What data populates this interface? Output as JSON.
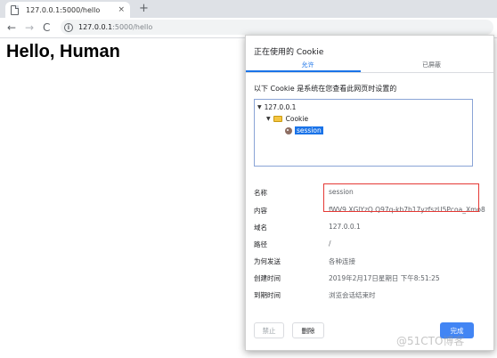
{
  "browser": {
    "tab_title": "127.0.0.1:5000/hello",
    "tab_close": "×",
    "new_tab": "+",
    "back": "←",
    "forward": "→",
    "reload": "C",
    "url_host": "127.0.0.1",
    "url_path": ":5000/hello",
    "info_glyph": "i"
  },
  "page": {
    "heading": "Hello, Human"
  },
  "dialog": {
    "title": "正在使用的 Cookie",
    "tabs": [
      "允许",
      "已屏蔽"
    ],
    "description": "以下 Cookie 是系统在您查看此网页时设置的",
    "tree": {
      "host": "127.0.0.1",
      "folder": "Cookie",
      "item": "session"
    },
    "fields": [
      {
        "label": "名称",
        "value": "session"
      },
      {
        "label": "内容",
        "value": "fWV9.XGlYzQ.Q97q-kb7b17yzfszU5Pcoa_Xmo8"
      },
      {
        "label": "域名",
        "value": "127.0.0.1"
      },
      {
        "label": "路径",
        "value": "/"
      },
      {
        "label": "为何发送",
        "value": "各种连接"
      },
      {
        "label": "创建时间",
        "value": "2019年2月17日星期日 下午8:51:25"
      },
      {
        "label": "到期时间",
        "value": "浏览会话结束时"
      }
    ],
    "buttons": {
      "disable": "禁止",
      "remove": "删除",
      "done": "完成"
    },
    "colors": {
      "accent": "#1a73e8",
      "done_button": "#4285f4",
      "highlight_box": "#e53935"
    }
  },
  "watermark": "@51CTO博客"
}
